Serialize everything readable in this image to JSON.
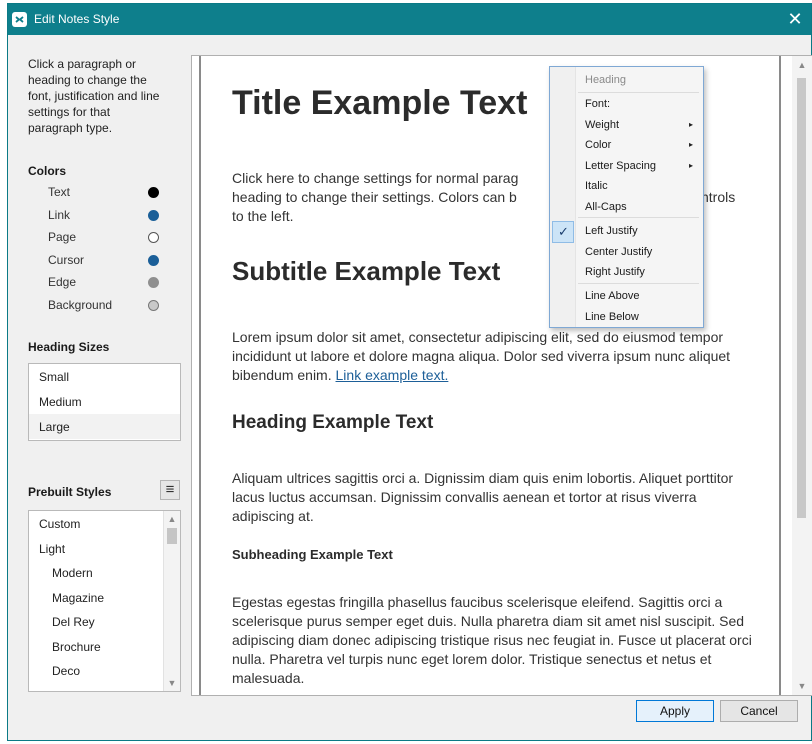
{
  "window": {
    "title": "Edit Notes Style",
    "close_glyph": "✕",
    "accent_color": "#0e7f8c"
  },
  "sidebar": {
    "instructions": "Click a paragraph or heading to change the font, justification and line settings for that paragraph type.",
    "colors_title": "Colors",
    "colors": [
      {
        "label": "Text",
        "fill": "#000000",
        "border": "#000000"
      },
      {
        "label": "Link",
        "fill": "#1b5f98",
        "border": "#1b5f98"
      },
      {
        "label": "Page",
        "fill": "#ffffff",
        "border": "#555555"
      },
      {
        "label": "Cursor",
        "fill": "#1b5f98",
        "border": "#1b5f98"
      },
      {
        "label": "Edge",
        "fill": "#8f8f8f",
        "border": "#8f8f8f"
      },
      {
        "label": "Background",
        "fill": "#c8c8c8",
        "border": "#777777"
      }
    ],
    "heading_sizes_title": "Heading Sizes",
    "heading_sizes": [
      "Small",
      "Medium",
      "Large"
    ],
    "heading_size_selected": "Large",
    "prebuilt_title": "Prebuilt Styles",
    "prebuilt_menu_icon": "≡",
    "prebuilt_styles": [
      "Custom",
      "Light",
      "Modern",
      "Magazine",
      "Del Rey",
      "Brochure",
      "Deco"
    ],
    "prebuilt_indented": [
      "Modern",
      "Magazine",
      "Del Rey",
      "Brochure",
      "Deco"
    ]
  },
  "preview": {
    "title": "Title Example Text",
    "body1": "Click here to change settings for normal parag",
    "body1_line2": "heading to change their settings. Colors can b",
    "body1_right1": "ntrols",
    "body1_line3": "to the left.",
    "subtitle": "Subtitle Example Text",
    "lorem1": "Lorem ipsum dolor sit amet, consectetur adipiscing elit, sed do eiusmod tempor incididunt ut labore et dolore magna aliqua. Dolor sed viverra ipsum nunc aliquet bibendum enim.",
    "link_text": "Link example text.",
    "heading": "Heading Example Text",
    "aliquam": "Aliquam ultrices sagittis orci a. Dignissim diam quis enim lobortis. Aliquet porttitor lacus luctus accumsan. Dignissim convallis aenean et tortor at risus viverra adipiscing at.",
    "subheading": "Subheading Example Text",
    "egestas": "Egestas egestas fringilla phasellus faucibus scelerisque eleifend. Sagittis orci a scelerisque purus semper eget duis. Nulla pharetra diam sit amet nisl suscipit. Sed adipiscing diam donec adipiscing tristique risus nec feugiat in. Fusce ut placerat orci nulla. Pharetra vel turpis nunc eget lorem dolor. Tristique senectus et netus et malesuada."
  },
  "context_menu": {
    "header": "Heading",
    "items": [
      "Font:",
      "Weight",
      "Color",
      "Letter Spacing",
      "Italic",
      "All-Caps"
    ],
    "justify": [
      "Left Justify",
      "Center Justify",
      "Right Justify"
    ],
    "lines": [
      "Line Above",
      "Line Below"
    ],
    "checked": "Left Justify",
    "check_glyph": "✓",
    "submenu_glyph": "▸"
  },
  "buttons": {
    "apply": "Apply",
    "cancel": "Cancel"
  }
}
